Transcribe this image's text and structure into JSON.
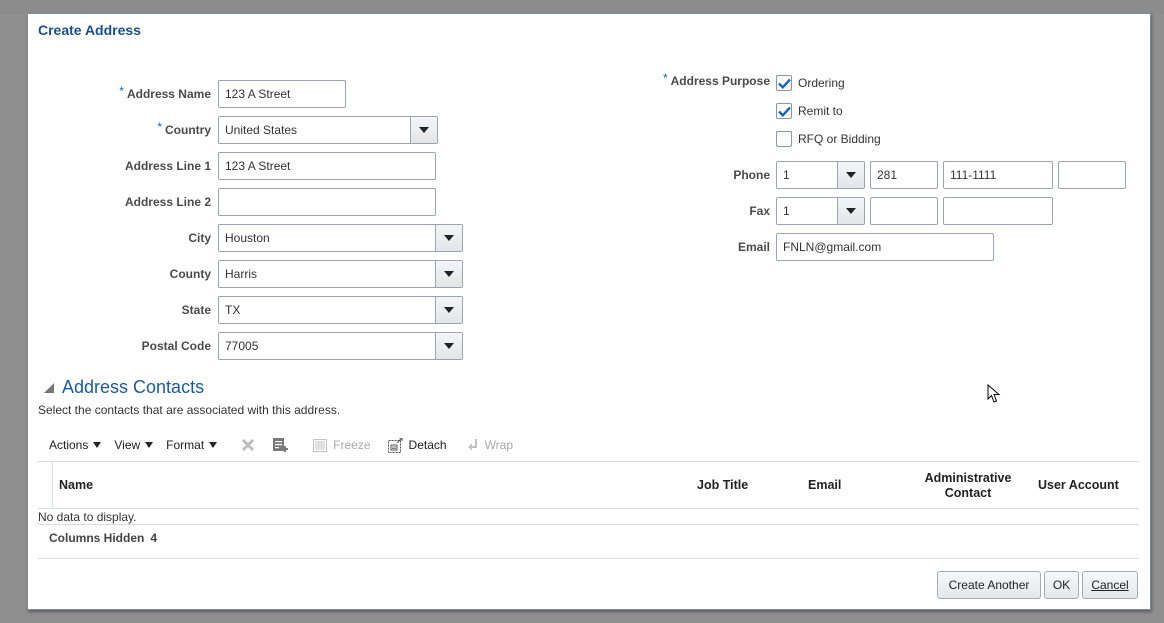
{
  "dialog": {
    "title": "Create Address"
  },
  "form_left": {
    "address_name": {
      "label": "Address Name",
      "required": true,
      "value": "123 A Street"
    },
    "country": {
      "label": "Country",
      "required": true,
      "value": "United States"
    },
    "address_line_1": {
      "label": "Address Line 1",
      "required": false,
      "value": "123 A Street"
    },
    "address_line_2": {
      "label": "Address Line 2",
      "required": false,
      "value": ""
    },
    "city": {
      "label": "City",
      "value": "Houston"
    },
    "county": {
      "label": "County",
      "value": "Harris"
    },
    "state": {
      "label": "State",
      "value": "TX"
    },
    "postal_code": {
      "label": "Postal Code",
      "value": "77005"
    }
  },
  "form_right": {
    "address_purpose": {
      "label": "Address Purpose",
      "required": true,
      "options": [
        {
          "label": "Ordering",
          "checked": true
        },
        {
          "label": "Remit to",
          "checked": true
        },
        {
          "label": "RFQ or Bidding",
          "checked": false
        }
      ]
    },
    "phone": {
      "label": "Phone",
      "country_code": "1",
      "area_code": "281",
      "number": "111-1111",
      "extension": ""
    },
    "fax": {
      "label": "Fax",
      "country_code": "1",
      "area_code": "",
      "number": ""
    },
    "email": {
      "label": "Email",
      "value": "FNLN@gmail.com"
    }
  },
  "contacts": {
    "title": "Address Contacts",
    "description": "Select the contacts that are associated with this address.",
    "toolbar": {
      "actions": "Actions",
      "view": "View",
      "format": "Format",
      "freeze": "Freeze",
      "detach": "Detach",
      "wrap": "Wrap"
    },
    "columns": [
      "Name",
      "Job Title",
      "Email",
      "Administrative Contact",
      "User Account"
    ],
    "empty_text": "No data to display.",
    "columns_hidden_label": "Columns Hidden",
    "columns_hidden_count": "4"
  },
  "footer": {
    "create_another": "Create Another",
    "ok": "OK",
    "cancel": "Cancel"
  },
  "colors": {
    "title_blue": "#1b4f8a",
    "check_blue": "#1b63b5"
  }
}
